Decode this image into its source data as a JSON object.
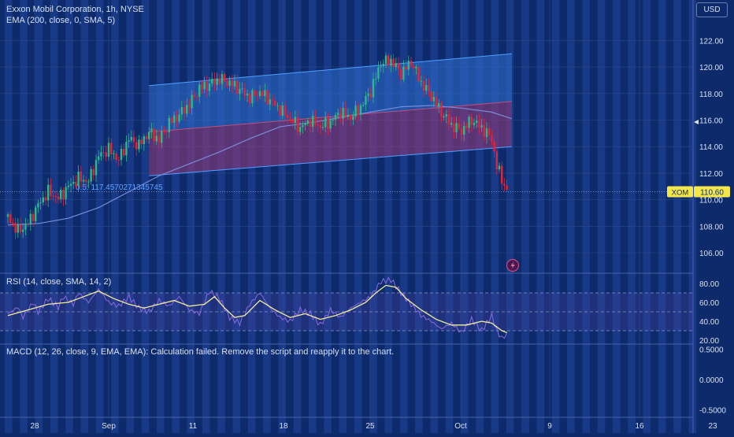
{
  "colors": {
    "background": "#0d2a6b",
    "stripe": "#1c3f8f",
    "grid": "#2d4a88",
    "up_candle": "#2eb88a",
    "down_candle": "#e2243a",
    "ema": "#7a8cd8",
    "channel_upper_fill": "#2f6fd0",
    "channel_lower_fill": "#9b3a78",
    "channel_line": "#4ea0ff",
    "rsi": "#8a6be0",
    "rsi_ma": "#f4ef9a",
    "price_label_bg": "#f5e64a"
  },
  "header": {
    "title": "Exxon Mobil Corporation, 1h, NYSE",
    "indicator": "EMA (200, close, 0, SMA, 5)",
    "currency": "USD"
  },
  "rsi_panel": {
    "label": "RSI (14, close, SMA, 14, 2)"
  },
  "macd_panel": {
    "label": "MACD (12, 26, close, 9, EMA, EMA): Calculation failed. Remove the script and reapply it to the chart."
  },
  "channel_label": "0.5: 117.4570271345745",
  "chart_data": [
    {
      "type": "candlestick",
      "ticker": "XOM",
      "last_price": "110.60",
      "x_ticks": [
        "28",
        "Sep",
        "11",
        "18",
        "25",
        "Oct",
        "9",
        "16",
        "23"
      ],
      "y_ticks": [
        "106.00",
        "108.00",
        "110.00",
        "112.00",
        "114.00",
        "116.00",
        "118.00",
        "120.00",
        "122.00"
      ],
      "ylim": [
        104.6,
        123.3
      ],
      "close_path": [
        [
          0,
          108.7
        ],
        [
          2,
          107.6
        ],
        [
          4,
          108.2
        ],
        [
          6,
          109.6
        ],
        [
          8,
          110.6
        ],
        [
          10,
          110.1
        ],
        [
          12,
          111.0
        ],
        [
          14,
          111.6
        ],
        [
          16,
          111.4
        ],
        [
          18,
          113.3
        ],
        [
          20,
          113.8
        ],
        [
          22,
          113.0
        ],
        [
          24,
          114.6
        ],
        [
          26,
          114.1
        ],
        [
          28,
          115.1
        ],
        [
          30,
          114.5
        ],
        [
          32,
          115.8
        ],
        [
          34,
          116.4
        ],
        [
          36,
          117.2
        ],
        [
          38,
          118.4
        ],
        [
          40,
          118.7
        ],
        [
          42,
          119.1
        ],
        [
          44,
          118.8
        ],
        [
          46,
          118.3
        ],
        [
          48,
          117.7
        ],
        [
          50,
          118.1
        ],
        [
          52,
          117.5
        ],
        [
          54,
          116.8
        ],
        [
          56,
          116.1
        ],
        [
          58,
          115.4
        ],
        [
          60,
          116.0
        ],
        [
          62,
          115.5
        ],
        [
          64,
          115.9
        ],
        [
          66,
          116.6
        ],
        [
          68,
          116.2
        ],
        [
          70,
          117.0
        ],
        [
          72,
          118.2
        ],
        [
          74,
          120.3
        ],
        [
          76,
          120.5
        ],
        [
          78,
          119.5
        ],
        [
          80,
          120.4
        ],
        [
          82,
          118.8
        ],
        [
          84,
          117.8
        ],
        [
          86,
          116.6
        ],
        [
          88,
          115.6
        ],
        [
          90,
          115.2
        ],
        [
          92,
          116.0
        ],
        [
          94,
          115.4
        ],
        [
          96,
          114.6
        ],
        [
          97,
          112.5
        ],
        [
          98,
          111.6
        ],
        [
          99,
          110.6
        ]
      ],
      "ema_200": [
        [
          0,
          108.1
        ],
        [
          6,
          108.2
        ],
        [
          12,
          108.6
        ],
        [
          18,
          109.4
        ],
        [
          24,
          110.6
        ],
        [
          30,
          111.8
        ],
        [
          36,
          112.7
        ],
        [
          42,
          113.6
        ],
        [
          48,
          114.6
        ],
        [
          54,
          115.5
        ],
        [
          60,
          115.8
        ],
        [
          66,
          116.2
        ],
        [
          72,
          116.6
        ],
        [
          78,
          117.0
        ],
        [
          84,
          117.1
        ],
        [
          90,
          116.9
        ],
        [
          96,
          116.6
        ],
        [
          100,
          116.1
        ]
      ],
      "regression_channel": {
        "start": 28,
        "end": 100,
        "upper": [
          118.6,
          121.0
        ],
        "mid": [
          115.1,
          117.4
        ],
        "lower": [
          111.8,
          114.0
        ]
      }
    },
    {
      "type": "line",
      "name": "RSI (14, close, SMA, 14, 2)",
      "y_ticks": [
        "20.00",
        "40.00",
        "60.00",
        "80.00"
      ],
      "ylim": [
        17,
        86
      ],
      "levels": [
        70,
        50,
        30
      ],
      "rsi": [
        [
          0,
          48
        ],
        [
          2,
          55
        ],
        [
          3,
          44
        ],
        [
          5,
          60
        ],
        [
          6,
          50
        ],
        [
          8,
          64
        ],
        [
          10,
          55
        ],
        [
          11,
          66
        ],
        [
          13,
          58
        ],
        [
          14,
          70
        ],
        [
          16,
          60
        ],
        [
          18,
          74
        ],
        [
          20,
          60
        ],
        [
          22,
          56
        ],
        [
          24,
          66
        ],
        [
          26,
          54
        ],
        [
          28,
          50
        ],
        [
          30,
          62
        ],
        [
          32,
          56
        ],
        [
          34,
          66
        ],
        [
          36,
          52
        ],
        [
          38,
          48
        ],
        [
          40,
          72
        ],
        [
          42,
          64
        ],
        [
          44,
          44
        ],
        [
          46,
          38
        ],
        [
          48,
          58
        ],
        [
          50,
          70
        ],
        [
          52,
          54
        ],
        [
          54,
          44
        ],
        [
          56,
          40
        ],
        [
          58,
          52
        ],
        [
          60,
          48
        ],
        [
          62,
          36
        ],
        [
          64,
          52
        ],
        [
          66,
          44
        ],
        [
          68,
          54
        ],
        [
          70,
          60
        ],
        [
          72,
          66
        ],
        [
          74,
          82
        ],
        [
          76,
          84
        ],
        [
          78,
          70
        ],
        [
          80,
          58
        ],
        [
          82,
          46
        ],
        [
          84,
          40
        ],
        [
          86,
          32
        ],
        [
          88,
          38
        ],
        [
          90,
          28
        ],
        [
          92,
          42
        ],
        [
          94,
          30
        ],
        [
          96,
          46
        ],
        [
          97,
          30
        ],
        [
          98,
          22
        ],
        [
          99,
          26
        ]
      ],
      "rsi_ma": [
        [
          0,
          46
        ],
        [
          4,
          52
        ],
        [
          8,
          58
        ],
        [
          12,
          60
        ],
        [
          15,
          66
        ],
        [
          18,
          72
        ],
        [
          21,
          64
        ],
        [
          24,
          58
        ],
        [
          27,
          54
        ],
        [
          30,
          58
        ],
        [
          33,
          62
        ],
        [
          36,
          56
        ],
        [
          39,
          58
        ],
        [
          41,
          66
        ],
        [
          43,
          54
        ],
        [
          45,
          44
        ],
        [
          47,
          46
        ],
        [
          50,
          62
        ],
        [
          53,
          52
        ],
        [
          56,
          44
        ],
        [
          59,
          48
        ],
        [
          62,
          42
        ],
        [
          65,
          46
        ],
        [
          68,
          52
        ],
        [
          71,
          60
        ],
        [
          73,
          70
        ],
        [
          75,
          78
        ],
        [
          77,
          76
        ],
        [
          79,
          64
        ],
        [
          82,
          52
        ],
        [
          85,
          42
        ],
        [
          88,
          36
        ],
        [
          91,
          36
        ],
        [
          94,
          40
        ],
        [
          96,
          38
        ],
        [
          98,
          30
        ],
        [
          99,
          28
        ]
      ]
    },
    {
      "type": "line",
      "name": "MACD (12, 26, close, 9, EMA, EMA)",
      "y_ticks": [
        "0.5000",
        "0.0000",
        "-0.5000"
      ],
      "ylim": [
        -0.55,
        0.62
      ]
    }
  ]
}
